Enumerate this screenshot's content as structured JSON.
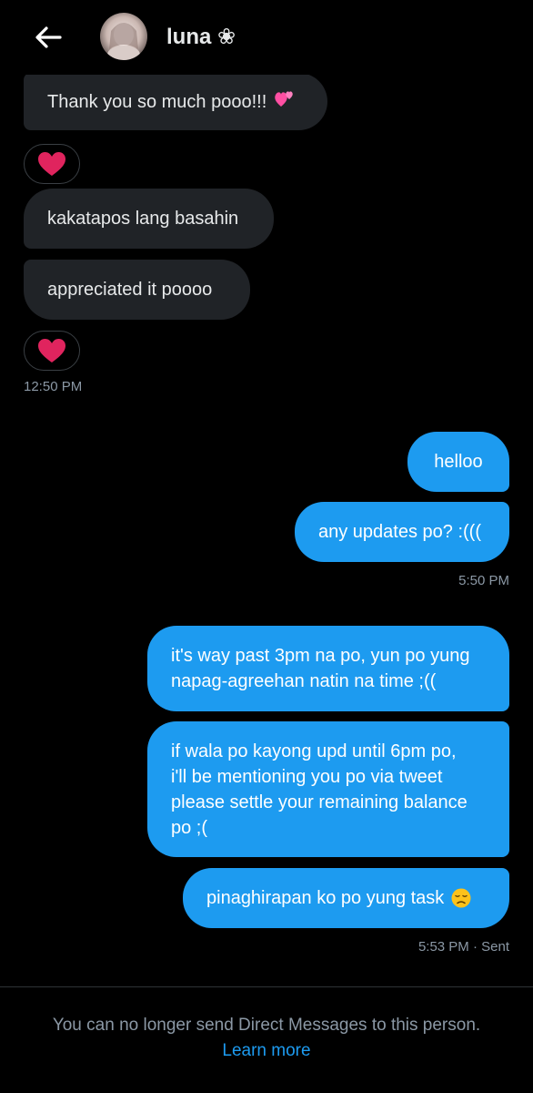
{
  "header": {
    "contact_name": "luna ❀",
    "back_icon": "arrow-left-icon"
  },
  "messages": [
    {
      "dir": "in",
      "text": "Thank you so much pooo!!!",
      "emoji": "two-hearts-icon"
    },
    {
      "dir": "in",
      "reaction": "heart-icon"
    },
    {
      "dir": "in",
      "text": "kakatapos lang basahin"
    },
    {
      "dir": "in",
      "text": "appreciated it poooo"
    },
    {
      "dir": "in",
      "reaction": "heart-icon"
    },
    {
      "dir": "out",
      "text": "helloo"
    },
    {
      "dir": "out",
      "text": "any updates po? :((("
    },
    {
      "dir": "out",
      "lines": [
        "it's way past 3pm na po, yun po yung",
        "napag-agreehan natin na time ;(("
      ]
    },
    {
      "dir": "out",
      "lines": [
        "if wala po kayong upd until 6pm po,",
        "i'll be mentioning you po via tweet",
        "please settle your remaining balance",
        "po ;("
      ]
    },
    {
      "dir": "out",
      "text": "pinaghirapan ko po yung task",
      "emoji": "disappointed-face-icon"
    }
  ],
  "timestamps": {
    "t1": "12:50 PM",
    "t2": "5:50 PM",
    "t3": "5:53 PM · Sent"
  },
  "footer": {
    "notice": "You can no longer send Direct Messages to this person.",
    "learn_more": "Learn more"
  },
  "colors": {
    "accent": "#1d9bf0",
    "incoming_bubble": "#202327",
    "background": "#000000",
    "muted_text": "#8b98a5",
    "heart": "#e0245e"
  }
}
